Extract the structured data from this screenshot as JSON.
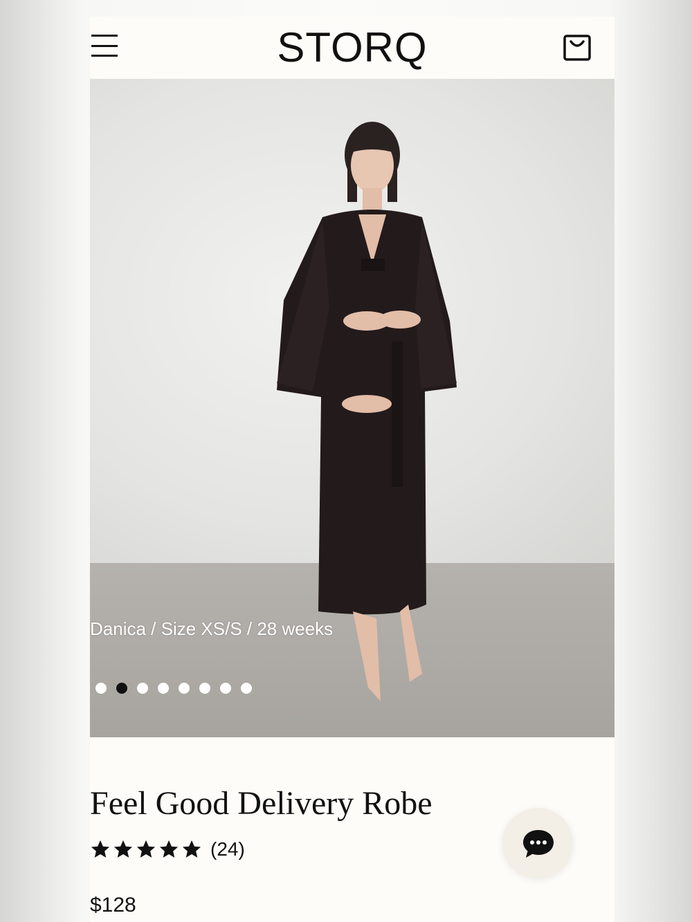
{
  "header": {
    "logo": "STORQ"
  },
  "hero": {
    "caption": "Danica / Size XS/S / 28 weeks",
    "slides_total": 8,
    "active_slide": 2
  },
  "product": {
    "title": "Feel Good Delivery Robe",
    "rating_stars": 5,
    "review_count": "(24)",
    "price": "$128"
  },
  "icons": {
    "menu": "hamburger-menu-icon",
    "cart": "shopping-bag-icon",
    "chat": "chat-bubble-icon",
    "star": "star-icon"
  },
  "colors": {
    "page_bg": "#fdfcf8",
    "text": "#111111",
    "chat_bg": "#f3efe6"
  }
}
